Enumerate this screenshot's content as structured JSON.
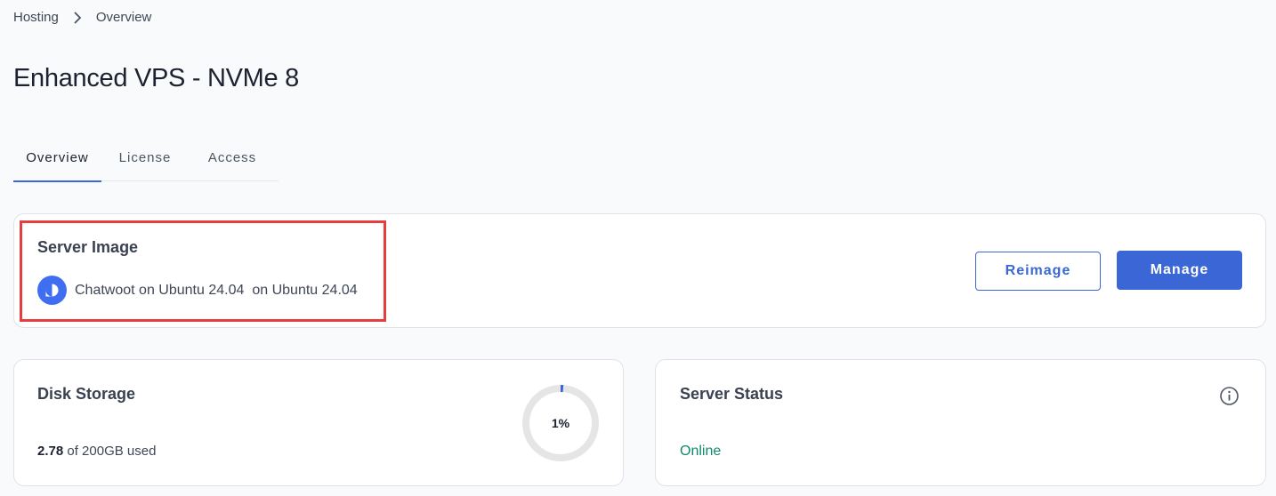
{
  "breadcrumb": {
    "items": [
      "Hosting",
      "Overview"
    ]
  },
  "page": {
    "title": "Enhanced VPS - NVMe 8"
  },
  "tabs": [
    {
      "label": "Overview",
      "active": true
    },
    {
      "label": "License",
      "active": false
    },
    {
      "label": "Access",
      "active": false
    }
  ],
  "server_image": {
    "title": "Server Image",
    "app_name": "Chatwoot on Ubuntu 24.04",
    "os_label": "on Ubuntu 24.04",
    "icon": "chatwoot-icon"
  },
  "buttons": {
    "reimage": "Reimage",
    "manage": "Manage"
  },
  "disk": {
    "title": "Disk Storage",
    "used_value": "2.78",
    "used_suffix": "of 200GB used",
    "percent_label": "1%",
    "percent": 0.01
  },
  "status": {
    "title": "Server Status",
    "value": "Online"
  },
  "colors": {
    "accent": "#3b66d6",
    "online": "#0f8a6b",
    "highlight": "#e53e3e",
    "gauge_track": "#e5e5e5"
  }
}
